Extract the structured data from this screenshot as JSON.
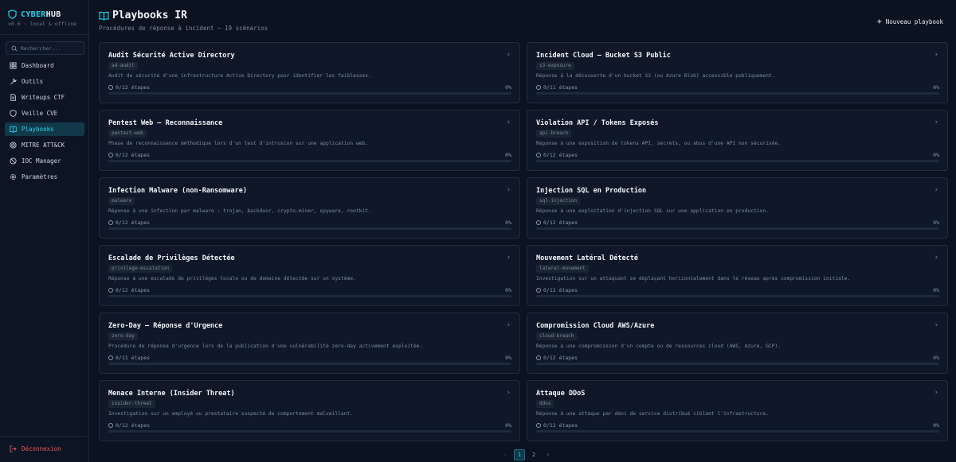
{
  "app": {
    "brand_a": "CYBER",
    "brand_b": "HUB",
    "version": "v0.6 · local & offline"
  },
  "search": {
    "placeholder": "Rechercher..."
  },
  "nav": [
    {
      "label": "Dashboard",
      "icon": "dashboard-icon",
      "active": false
    },
    {
      "label": "Outils",
      "icon": "wrench-icon",
      "active": false
    },
    {
      "label": "Writeups CTF",
      "icon": "document-icon",
      "active": false
    },
    {
      "label": "Veille CVE",
      "icon": "shield-icon",
      "active": false
    },
    {
      "label": "Playbooks",
      "icon": "book-icon",
      "active": true
    },
    {
      "label": "MITRE ATT&CK",
      "icon": "target-icon",
      "active": false
    },
    {
      "label": "IOC Manager",
      "icon": "ioc-icon",
      "active": false
    },
    {
      "label": "Paramètres",
      "icon": "gear-icon",
      "active": false
    }
  ],
  "logout": {
    "label": "Déconnexion"
  },
  "page": {
    "title": "Playbooks IR",
    "subtitle": "Procédures de réponse à incident — 19 scénarios",
    "new_button": "Nouveau playbook"
  },
  "playbooks": [
    {
      "title": "Audit Sécurité Active Directory",
      "tag": "ad-audit",
      "desc": "Audit de sécurité d'une infrastructure Active Directory pour identifier les faiblesses.",
      "steps": "0/12 étapes",
      "progress": 0,
      "pct": "0%"
    },
    {
      "title": "Incident Cloud — Bucket S3 Public",
      "tag": "s3-exposure",
      "desc": "Réponse à la découverte d'un bucket S3 (ou Azure Blob) accessible publiquement.",
      "steps": "0/11 étapes",
      "progress": 0,
      "pct": "0%"
    },
    {
      "title": "Pentest Web — Reconnaissance",
      "tag": "pentest-web",
      "desc": "Phase de reconnaissance méthodique lors d'un test d'intrusion sur une application web.",
      "steps": "0/12 étapes",
      "progress": 0,
      "pct": "0%"
    },
    {
      "title": "Violation API / Tokens Exposés",
      "tag": "api-breach",
      "desc": "Réponse à une exposition de tokens API, secrets, ou abus d'une API non sécurisée.",
      "steps": "0/12 étapes",
      "progress": 0,
      "pct": "0%"
    },
    {
      "title": "Infection Malware (non-Ransomware)",
      "tag": "malware",
      "desc": "Réponse à une infection par malware : trojan, backdoor, crypto-miner, spyware, rootkit.",
      "steps": "0/12 étapes",
      "progress": 0,
      "pct": "0%"
    },
    {
      "title": "Injection SQL en Production",
      "tag": "sql-injection",
      "desc": "Réponse à une exploitation d'injection SQL sur une application en production.",
      "steps": "0/12 étapes",
      "progress": 0,
      "pct": "0%"
    },
    {
      "title": "Escalade de Privilèges Détectée",
      "tag": "privilege-escalation",
      "desc": "Réponse à une escalade de privilèges locale ou de domaine détectée sur un système.",
      "steps": "0/12 étapes",
      "progress": 0,
      "pct": "0%"
    },
    {
      "title": "Mouvement Latéral Détecté",
      "tag": "lateral-movement",
      "desc": "Investigation sur un attaquant se déplaçant horizontalement dans le réseau après compromission initiale.",
      "steps": "0/12 étapes",
      "progress": 0,
      "pct": "0%"
    },
    {
      "title": "Zero-Day — Réponse d'Urgence",
      "tag": "zero-day",
      "desc": "Procédure de réponse d'urgence lors de la publication d'une vulnérabilité zero-day activement exploitée.",
      "steps": "0/11 étapes",
      "progress": 0,
      "pct": "0%"
    },
    {
      "title": "Compromission Cloud AWS/Azure",
      "tag": "cloud-breach",
      "desc": "Réponse à une compromission d'un compte ou de ressources cloud (AWS, Azure, GCP).",
      "steps": "0/12 étapes",
      "progress": 0,
      "pct": "0%"
    },
    {
      "title": "Menace Interne (Insider Threat)",
      "tag": "insider-threat",
      "desc": "Investigation sur un employé ou prestataire suspecté de comportement malveillant.",
      "steps": "0/12 étapes",
      "progress": 0,
      "pct": "0%"
    },
    {
      "title": "Attaque DDoS",
      "tag": "ddos",
      "desc": "Réponse à une attaque par déni de service distribué ciblant l'infrastructure.",
      "steps": "0/12 étapes",
      "progress": 0,
      "pct": "0%"
    }
  ],
  "pagination": {
    "pages": [
      "1",
      "2"
    ],
    "current": "1",
    "prev": "‹",
    "next": "›"
  },
  "colors": {
    "accent": "#22d3ee",
    "danger": "#f05252",
    "background": "#0b1320",
    "card": "#0f1828"
  }
}
